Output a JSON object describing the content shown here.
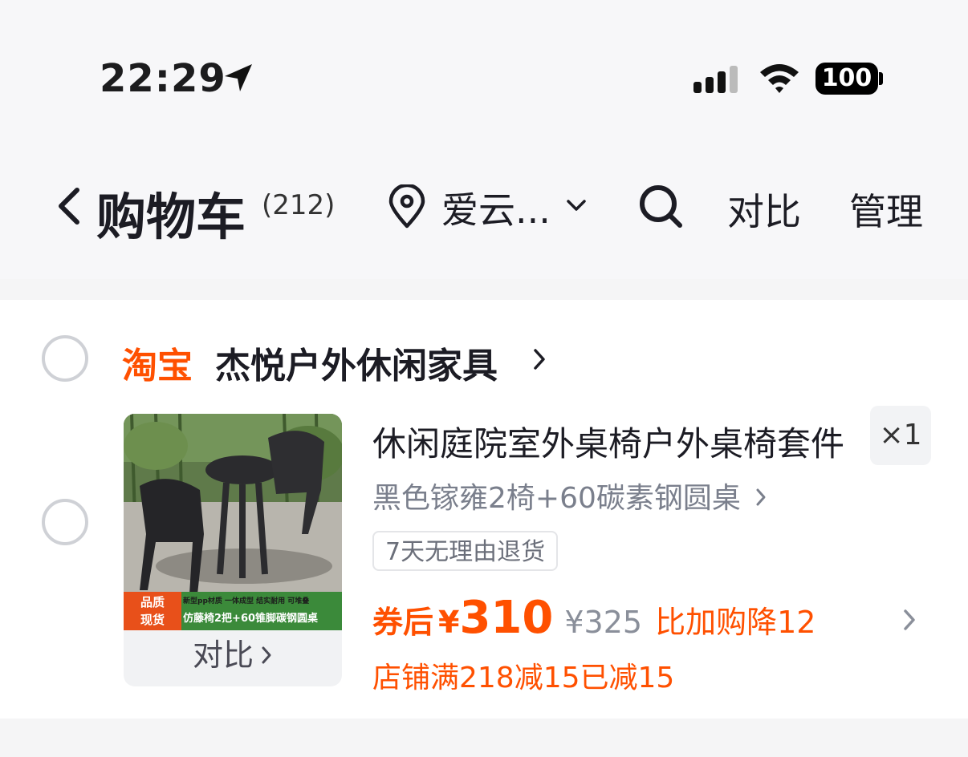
{
  "status_bar": {
    "time": "22:29",
    "battery": "100"
  },
  "nav": {
    "title": "购物车",
    "count": "(212)",
    "location": "爱云...",
    "compare": "对比",
    "manage": "管理"
  },
  "shop": {
    "platform": "淘宝",
    "name": "杰悦户外休闲家具"
  },
  "item": {
    "title": "休闲庭院室外桌椅户外桌椅套件",
    "quantity": "×1",
    "sku": "黑色镓雍2椅+60碳素钢圆桌",
    "return_policy": "7天无理由退货",
    "coupon_label": "券后",
    "currency": "¥",
    "price": "310",
    "original_price": "¥325",
    "compare_note": "比加购降12",
    "promo": "店铺满218减15已减15",
    "thumb_compare": "对比",
    "thumb_badge": "品质\n现货",
    "thumb_features": "新型pp材质 一体成型 结实耐用 可堆叠",
    "thumb_caption": "仿藤椅2把+60锥脚碳钢圆桌"
  },
  "colors": {
    "accent": "#ff5000",
    "text": "#1c1c24",
    "muted": "#7a7f8c"
  }
}
